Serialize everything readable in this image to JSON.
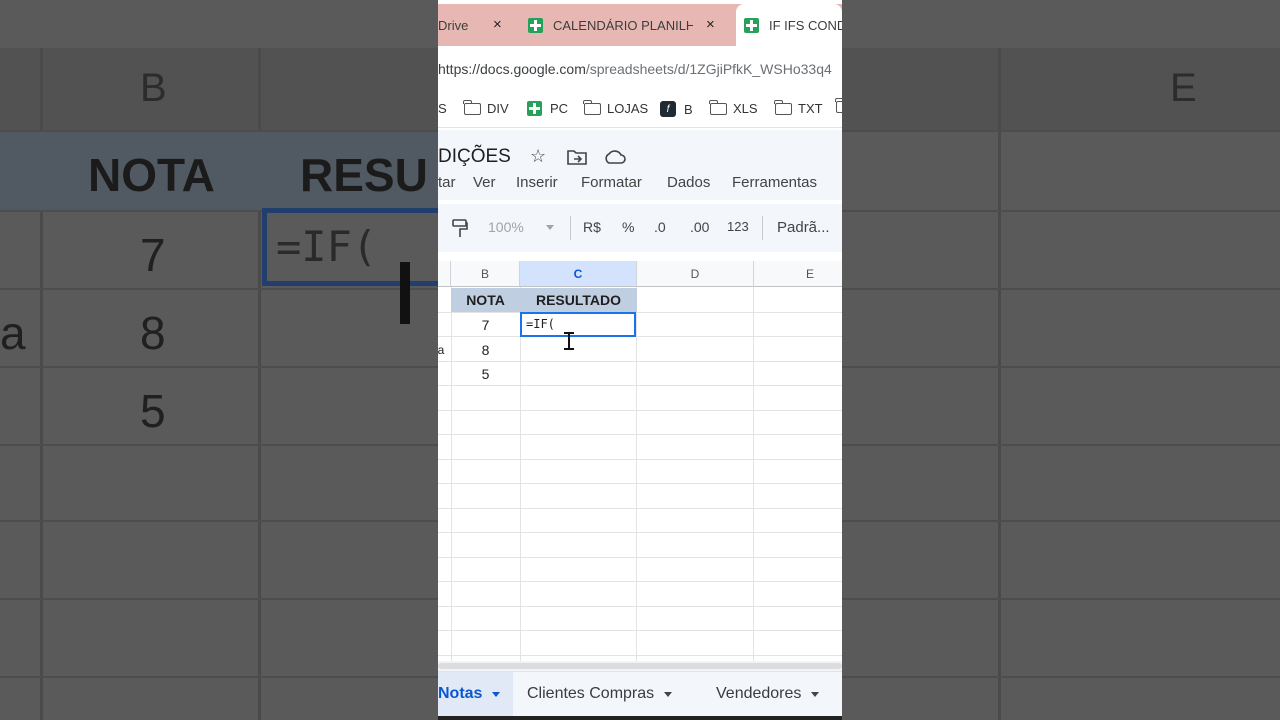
{
  "background": {
    "col_letters": [
      "B",
      "E"
    ],
    "header_text": [
      "NOTA",
      "RESU"
    ],
    "values": [
      "7",
      "8",
      "5"
    ],
    "fragment": "a",
    "formula": "=IF("
  },
  "browser": {
    "tabs": [
      {
        "label": "Drive"
      },
      {
        "label": "CALENDÁRIO PLANILHA"
      },
      {
        "label": "IF IFS CONDI"
      }
    ],
    "close_glyph": "×",
    "url_host": "https://docs.google.com",
    "url_path": "/spreadsheets/d/1ZGjiPfkK_WSHo33q4",
    "bookmarks": [
      {
        "label": "S",
        "icon": "none"
      },
      {
        "label": "DIV",
        "icon": "folder-icon"
      },
      {
        "label": "PC",
        "icon": "sheets-icon"
      },
      {
        "label": "LOJAS",
        "icon": "folder-icon"
      },
      {
        "label": "B",
        "icon": "b-icon"
      },
      {
        "label": "XLS",
        "icon": "folder-icon"
      },
      {
        "label": "TXT",
        "icon": "folder-icon"
      }
    ]
  },
  "doc": {
    "title": "DIÇÕES",
    "star_glyph": "☆",
    "menu": [
      "tar",
      "Ver",
      "Inserir",
      "Formatar",
      "Dados",
      "Ferramentas"
    ]
  },
  "toolbar": {
    "zoom": "100%",
    "currency": "R$",
    "percent": "%",
    "decrease_decimal": ".0",
    "increase_decimal": ".00",
    "number_format": "123",
    "font": "Padrã..."
  },
  "grid": {
    "columns": [
      "B",
      "C",
      "D",
      "E"
    ],
    "selected_column": "C",
    "rows": [
      {
        "a": "",
        "b": "NOTA",
        "c": "RESULTADO"
      },
      {
        "a": "",
        "b": "7",
        "c": ""
      },
      {
        "a": "a",
        "b": "8",
        "c": ""
      },
      {
        "a": "",
        "b": "5",
        "c": ""
      }
    ],
    "active_cell_formula": "=IF("
  },
  "sheet_tabs": [
    {
      "label": "Notas",
      "active": true
    },
    {
      "label": "Clientes Compras",
      "active": false
    },
    {
      "label": "Vendedores",
      "active": false
    }
  ],
  "colors": {
    "header_fill": "#bfcfe1",
    "selection": "#1a73e8",
    "sheets_green": "#26a15a",
    "active_tab_bar": "#e7b8b3"
  }
}
